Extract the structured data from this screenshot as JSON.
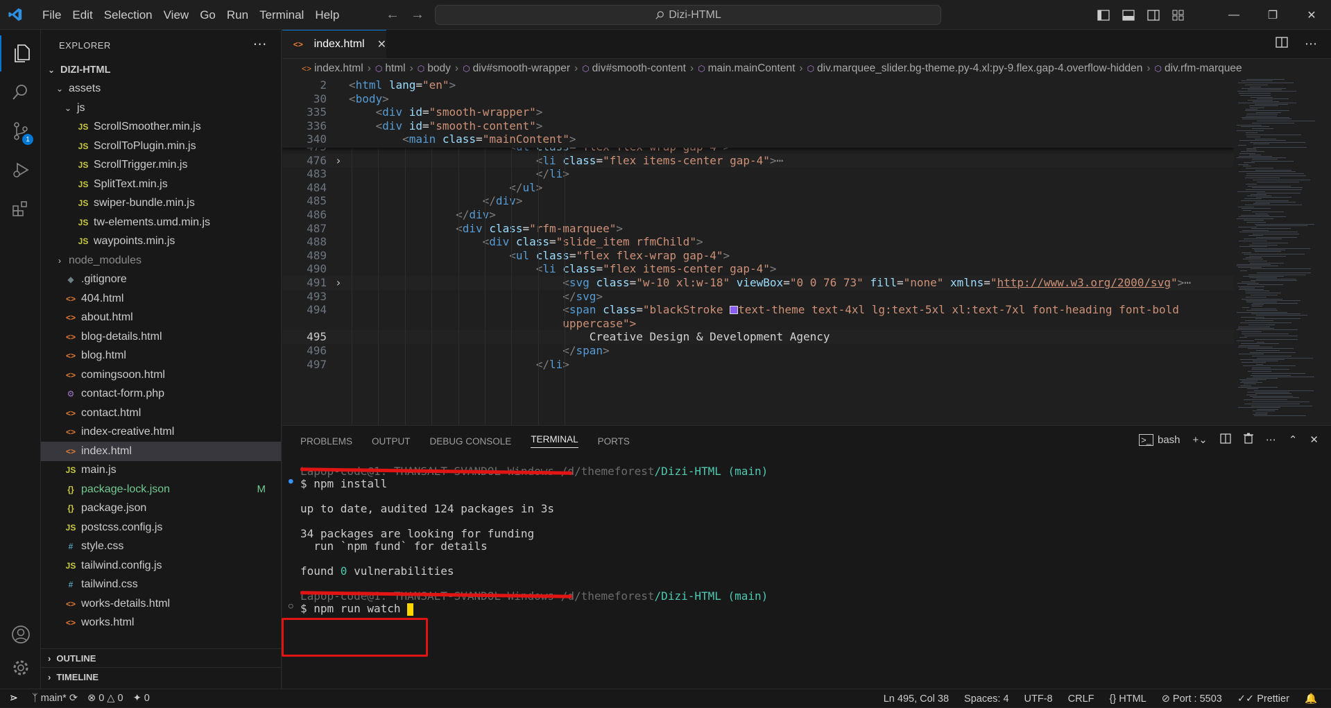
{
  "menu": [
    "File",
    "Edit",
    "Selection",
    "View",
    "Go",
    "Run",
    "Terminal",
    "Help"
  ],
  "search": {
    "text": "Dizi-HTML"
  },
  "sidebar": {
    "title": "EXPLORER",
    "root": "DIZI-HTML",
    "folders": {
      "assets": "assets",
      "js": "js",
      "node_modules": "node_modules"
    },
    "js_files": [
      "ScrollSmoother.min.js",
      "ScrollToPlugin.min.js",
      "ScrollTrigger.min.js",
      "SplitText.min.js",
      "swiper-bundle.min.js",
      "tw-elements.umd.min.js",
      "waypoints.min.js"
    ],
    "files": [
      {
        "name": ".gitignore",
        "icon": "git"
      },
      {
        "name": "404.html",
        "icon": "html"
      },
      {
        "name": "about.html",
        "icon": "html"
      },
      {
        "name": "blog-details.html",
        "icon": "html"
      },
      {
        "name": "blog.html",
        "icon": "html"
      },
      {
        "name": "comingsoon.html",
        "icon": "html"
      },
      {
        "name": "contact-form.php",
        "icon": "php"
      },
      {
        "name": "contact.html",
        "icon": "html"
      },
      {
        "name": "index-creative.html",
        "icon": "html"
      },
      {
        "name": "index.html",
        "icon": "html"
      },
      {
        "name": "main.js",
        "icon": "js"
      },
      {
        "name": "package-lock.json",
        "icon": "json",
        "badge": "M"
      },
      {
        "name": "package.json",
        "icon": "json"
      },
      {
        "name": "postcss.config.js",
        "icon": "js"
      },
      {
        "name": "style.css",
        "icon": "css"
      },
      {
        "name": "tailwind.config.js",
        "icon": "js"
      },
      {
        "name": "tailwind.css",
        "icon": "css"
      },
      {
        "name": "works-details.html",
        "icon": "html"
      },
      {
        "name": "works.html",
        "icon": "html"
      }
    ],
    "outline": "OUTLINE",
    "timeline": "TIMELINE"
  },
  "activity": {
    "scm_badge": "1"
  },
  "editor": {
    "tab": "index.html",
    "breadcrumb": [
      "index.html",
      "html",
      "body",
      "div#smooth-wrapper",
      "div#smooth-content",
      "main.mainContent",
      "div.marquee_slider.bg-theme.py-4.xl:py-9.flex.gap-4.overflow-hidden",
      "div.rfm-marquee"
    ],
    "sticky_lines": [
      {
        "n": "2",
        "code": "<html lang=\"en\">"
      },
      {
        "n": "30",
        "code": "<body>"
      },
      {
        "n": "335",
        "code": "    <div id=\"smooth-wrapper\">"
      },
      {
        "n": "336",
        "code": "    <div id=\"smooth-content\">"
      },
      {
        "n": "340",
        "code": "        <main class=\"mainContent\">"
      }
    ],
    "lines": [
      {
        "n": "475",
        "code": "                        <ul class=\"flex flex-wrap gap-4\">"
      },
      {
        "n": "476",
        "code": "                            <li class=\"flex items-center gap-4\">⋯",
        "fold": true
      },
      {
        "n": "483",
        "code": "                            </li>"
      },
      {
        "n": "484",
        "code": "                        </ul>"
      },
      {
        "n": "485",
        "code": "                    </div>"
      },
      {
        "n": "486",
        "code": "                </div>"
      },
      {
        "n": "487",
        "code": "                <div class=\"rfm-marquee\">"
      },
      {
        "n": "488",
        "code": "                    <div class=\"slide_item rfmChild\">"
      },
      {
        "n": "489",
        "code": "                        <ul class=\"flex flex-wrap gap-4\">"
      },
      {
        "n": "490",
        "code": "                            <li class=\"flex items-center gap-4\">"
      },
      {
        "n": "491",
        "code": "                                <svg class=\"w-10 xl:w-18\" viewBox=\"0 0 76 73\" fill=\"none\" xmlns=\"http://www.w3.org/2000/svg\">⋯",
        "fold": true
      },
      {
        "n": "493",
        "code": "                                </svg>"
      },
      {
        "n": "494",
        "code": "                                <span class=\"blackStroke ■text-theme text-4xl lg:text-5xl xl:text-7xl font-heading font-bold"
      },
      {
        "n": "",
        "code": "                                uppercase\">"
      },
      {
        "n": "495",
        "code": "                                    Creative Design & Development Agency"
      },
      {
        "n": "496",
        "code": "                                </span>"
      },
      {
        "n": "497",
        "code": "                            </li>"
      }
    ]
  },
  "panel": {
    "tabs": [
      "PROBLEMS",
      "OUTPUT",
      "DEBUG CONSOLE",
      "TERMINAL",
      "PORTS"
    ],
    "active_tab": "TERMINAL",
    "shell": "bash",
    "terminal": {
      "prompt1_path": "/Dizi-HTML",
      "branch": "(main)",
      "cmd1": "$ npm install",
      "out1": "up to date, audited 124 packages in 3s",
      "out2": "34 packages are looking for funding",
      "out3": "  run `npm fund` for details",
      "out4a": "found ",
      "out4b": "0",
      "out4c": " vulnerabilities",
      "prompt2_path": "/Dizi-HTML",
      "cmd2": "$ npm run watch "
    }
  },
  "status": {
    "branch": "main*",
    "errors": "0",
    "warnings": "0",
    "ports": "0",
    "position": "Ln 495, Col 38",
    "spaces": "Spaces: 4",
    "encoding": "UTF-8",
    "eol": "CRLF",
    "language": "HTML",
    "port": "Port : 5503",
    "prettier": "Prettier"
  },
  "colors": {
    "accent": "#0078d4",
    "annotation": "#e11414",
    "modified": "#73c991"
  }
}
